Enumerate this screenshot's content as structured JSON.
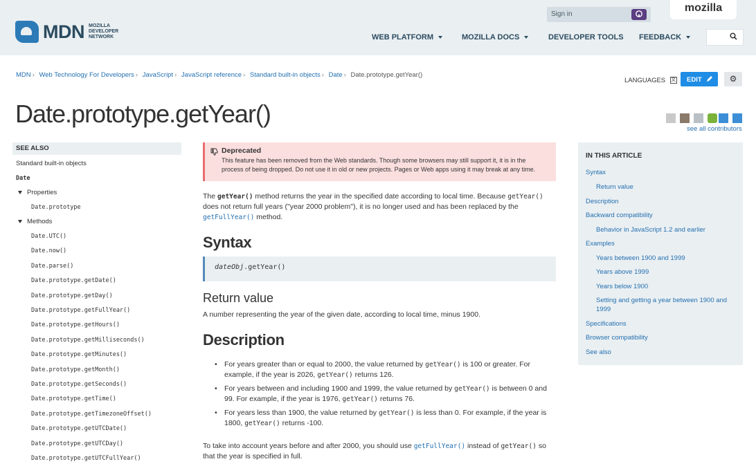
{
  "header": {
    "logo_text": "MDN",
    "logo_sub": "Mozilla Developer Network",
    "signin_label": "Sign in",
    "mozilla_label": "mozilla",
    "nav": [
      {
        "label": "WEB PLATFORM"
      },
      {
        "label": "MOZILLA DOCS"
      },
      {
        "label": "DEVELOPER TOOLS"
      },
      {
        "label": "FEEDBACK"
      }
    ],
    "search_icon": "search-icon",
    "github_icon": "github-icon"
  },
  "breadcrumb": [
    "MDN",
    "Web Technology For Developers",
    "JavaScript",
    "JavaScript reference",
    "Standard built-in objects",
    "Date",
    "Date.prototype.getYear()"
  ],
  "toolbar": {
    "languages_label": "LANGUAGES",
    "edit_label": "EDIT",
    "see_contributors": "see all contributors"
  },
  "title": "Date.prototype.getYear()",
  "sidebar": {
    "see_also": "SEE ALSO",
    "std_objects": "Standard built-in objects",
    "date": "Date",
    "properties": "Properties",
    "prototype": "Date.prototype",
    "methods": "Methods",
    "method_list": [
      "Date.UTC()",
      "Date.now()",
      "Date.parse()",
      "Date.prototype.getDate()",
      "Date.prototype.getDay()",
      "Date.prototype.getFullYear()",
      "Date.prototype.getHours()",
      "Date.prototype.getMilliseconds()",
      "Date.prototype.getMinutes()",
      "Date.prototype.getMonth()",
      "Date.prototype.getSeconds()",
      "Date.prototype.getTime()",
      "Date.prototype.getTimezoneOffset()",
      "Date.prototype.getUTCDate()",
      "Date.prototype.getUTCDay()",
      "Date.prototype.getUTCFullYear()"
    ]
  },
  "deprecated": {
    "title": "Deprecated",
    "text": "This feature has been removed from the Web standards. Though some browsers may still support it, it is in the process of being dropped. Do not use it in old or new projects. Pages or Web apps using it may break at any time."
  },
  "intro": {
    "p1": "The ",
    "code1": "getYear()",
    "p2": " method returns the year in the specified date according to local time. Because ",
    "code2": "getYear()",
    "p3": " does not return full years (\"year 2000 problem\"), it is no longer used and has been replaced by the ",
    "link": "getFullYear()",
    "p4": " method."
  },
  "syntax": {
    "heading": "Syntax",
    "obj": "dateObj",
    "call": ".getYear()"
  },
  "return_value": {
    "heading": "Return value",
    "text": "A number representing the year of the given date, according to local time, minus 1900."
  },
  "description": {
    "heading": "Description",
    "bullets": [
      {
        "a": "For years greater than or equal to 2000, the value returned by ",
        "c1": "getYear()",
        "b": " is 100 or greater. For example, if the year is 2026, ",
        "c2": "getYear()",
        "d": " returns 126."
      },
      {
        "a": "For years between and including 1900 and 1999, the value returned by ",
        "c1": "getYear()",
        "b": " is between 0 and 99. For example, if the year is 1976, ",
        "c2": "getYear()",
        "d": " returns 76."
      },
      {
        "a": "For years less than 1900, the value returned by ",
        "c1": "getYear()",
        "b": " is less than 0. For example, if the year is 1800, ",
        "c2": "getYear()",
        "d": " returns -100."
      }
    ],
    "closing_a": "To take into account years before and after 2000, you should use ",
    "closing_link": "getFullYear()",
    "closing_b": " instead of ",
    "closing_code": "getYear()",
    "closing_c": " so that the year is specified in full."
  },
  "toc": {
    "heading": "IN THIS ARTICLE",
    "items": [
      "Syntax",
      "Return value",
      "Description",
      "Backward compatibility",
      "Behavior in JavaScript 1.2 and earlier",
      "Examples",
      "Years between 1900 and 1999",
      "Years above 1999",
      "Years below 1900",
      "Setting and getting a year between 1900 and",
      "1999",
      "Specifications",
      "Browser compatibility",
      "See also"
    ]
  },
  "colors": {
    "link": "#2470b0",
    "header_bg": "#eaeff2",
    "edit_button": "#1f8de5",
    "deprecated_bg": "#fbdfdf"
  }
}
